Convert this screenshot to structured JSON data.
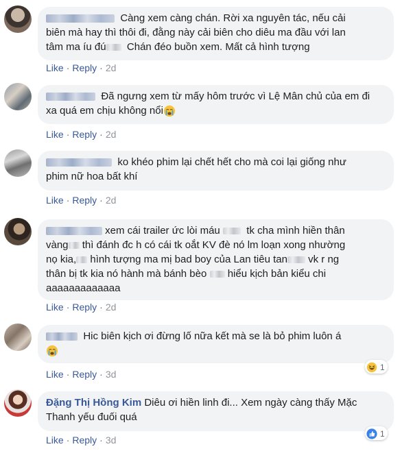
{
  "actions": {
    "like": "Like",
    "reply": "Reply",
    "separator": "·"
  },
  "comments": [
    {
      "author": "",
      "line1": "Càng xem càng chán. Rời xa nguyên tác, nếu cải",
      "line2": "biên mà hay thì thôi đi, đằng này cải biên cho diêu ma đầu với lan",
      "line3a": "tâm ma íu đú",
      "line3b": "Chán đéo buồn xem. Mất cả hình tượng",
      "time": "2d"
    },
    {
      "author": "",
      "line1": "Đã ngưng xem từ mấy hôm trước vì Lệ Mân chủ của em đi",
      "line2": "xa quá em chịu không nổi",
      "time": "2d"
    },
    {
      "author": "",
      "line1": "ko khéo phim lại chết hết cho mà coi lại giống như",
      "line2": "phim nữ hoa bất khí",
      "time": "2d"
    },
    {
      "author": "",
      "line1a": "xem cái trailer ức lòi máu",
      "line1b": "tk cha mình hiền thân",
      "line2a": "vàng",
      "line2b": "thì đánh đc h có cái tk oắt KV đè nó lm loạn xong nhường",
      "line3a": "nọ kia,",
      "line3b": "hình tượng ma mị bad boy của Lan tiêu tan",
      "line3c": "vk r ng",
      "line4a": "thân bị tk kia nó hành mà bánh bèo",
      "line4b": "hiểu kịch bản kiểu chi",
      "line5": "aaaaaaaaaaaaa",
      "time": "2d"
    },
    {
      "author": "",
      "line1": "Hic biên kịch ơi đừng lố nữa kết mà se là bỏ phim luôn á",
      "time": "3d",
      "reaction": "laugh",
      "reaction_count": "1"
    },
    {
      "author": "Đặng Thị Hồng Kim",
      "line1": "Diêu ơi hiền linh đi... Xem ngày càng thấy Mặc",
      "line2": "Thanh yếu đuối quá",
      "time": "3d",
      "reaction": "like",
      "reaction_count": "1"
    }
  ],
  "colors": {
    "link": "#385898",
    "bubble": "#f2f3f5",
    "time": "#90949c"
  }
}
